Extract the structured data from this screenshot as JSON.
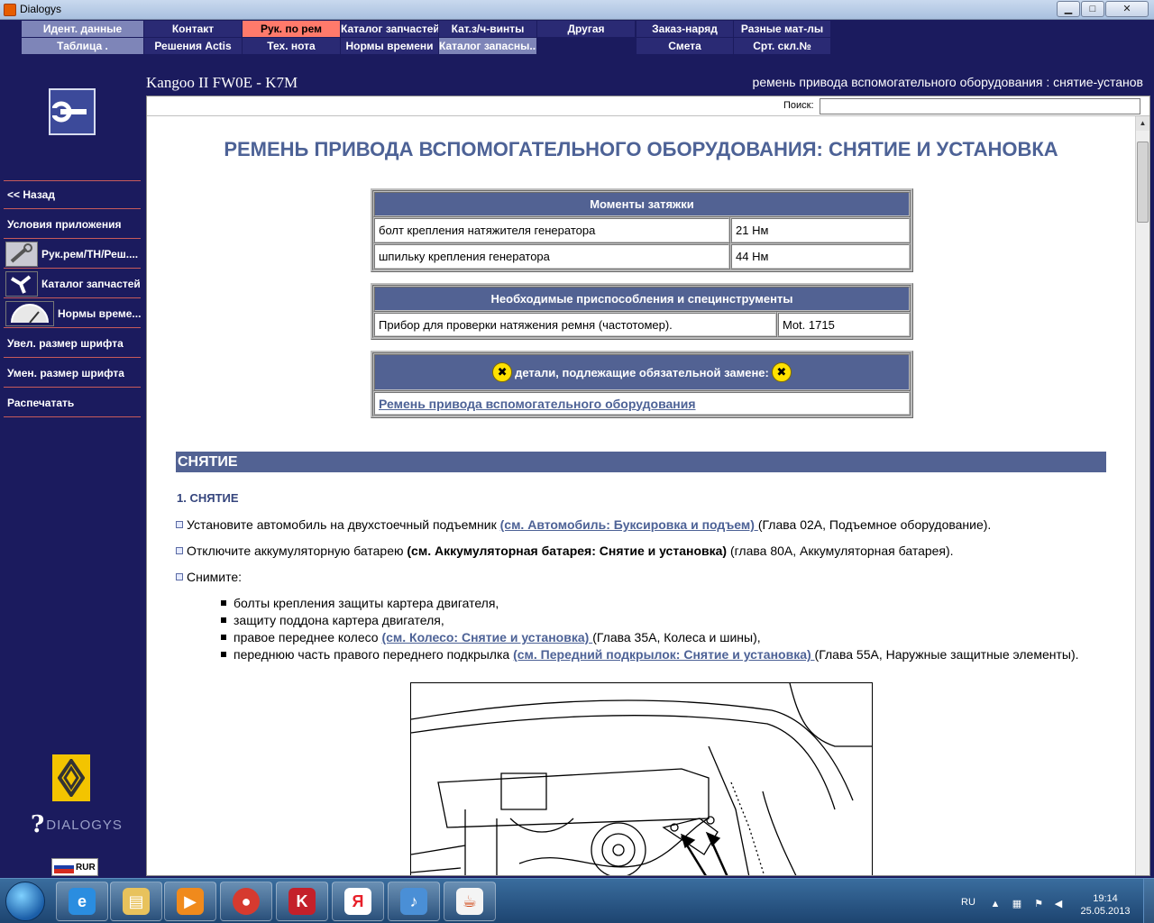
{
  "window": {
    "title": "Dialogys",
    "minimize": "▁",
    "maximize": "□",
    "close": "✕"
  },
  "menu": {
    "row1": [
      {
        "label": "Идент. данные",
        "style": "light",
        "w": 136
      },
      {
        "label": "Контакт",
        "style": "dark",
        "w": 109
      },
      {
        "label": "Рук. по рем",
        "style": "active",
        "w": 109
      },
      {
        "label": "Каталог запчастей",
        "style": "dark",
        "w": 109
      },
      {
        "label": "Кат.з/ч-винты",
        "style": "dark",
        "w": 109
      },
      {
        "label": "Другая",
        "style": "dark",
        "w": 109
      },
      {
        "label": "",
        "style": "blank",
        "w": 1
      },
      {
        "label": "Заказ-наряд",
        "style": "dark",
        "w": 108
      },
      {
        "label": "Разные мат-лы",
        "style": "dark",
        "w": 108
      }
    ],
    "row2": [
      {
        "label": "Таблица .",
        "style": "light",
        "w": 136
      },
      {
        "label": "Решения Actis",
        "style": "dark",
        "w": 109
      },
      {
        "label": "Тех. нота",
        "style": "dark",
        "w": 109
      },
      {
        "label": "Нормы времени",
        "style": "dark",
        "w": 109
      },
      {
        "label": "Каталог запасны...",
        "style": "light",
        "w": 109
      },
      {
        "label": "",
        "style": "blank",
        "w": 110
      },
      {
        "label": "Смета",
        "style": "dark",
        "w": 108
      },
      {
        "label": "Срт. скл.№",
        "style": "dark",
        "w": 108
      }
    ]
  },
  "header": {
    "vehicle": "Kangoo II FW0E - K7M",
    "procedure": "ремень привода вспомогательного оборудования : снятие-установ"
  },
  "sidebar": {
    "items": [
      {
        "label": "<< Назад",
        "thumb": ""
      },
      {
        "label": "Условия приложения",
        "thumb": ""
      },
      {
        "label": "Рук.рем/ТН/Реш....",
        "thumb": "wrench"
      },
      {
        "label": "Каталог запчастей",
        "thumb": "tool"
      },
      {
        "label": "Нормы време...",
        "thumb": "gauge"
      },
      {
        "label": "Увел. размер шрифта",
        "thumb": ""
      },
      {
        "label": "Умен. размер шрифта",
        "thumb": ""
      },
      {
        "label": "Распечатать",
        "thumb": ""
      }
    ],
    "brand": "DIALOGYS",
    "currency": "RUR"
  },
  "search": {
    "label": "Поиск:",
    "value": ""
  },
  "doc": {
    "title": "РЕМЕНЬ ПРИВОДА ВСПОМОГАТЕЛЬНОГО ОБОРУДОВАНИЯ: СНЯТИЕ И УСТАНОВКА",
    "torque": {
      "header": "Моменты затяжки",
      "rows": [
        {
          "item": "болт крепления натяжителя генератора",
          "value": "21 Нм"
        },
        {
          "item": "шпильку крепления генератора",
          "value": "44 Нм"
        }
      ]
    },
    "tools": {
      "header": "Необходимые приспособления и специнструменты",
      "rows": [
        {
          "item": "Прибор для проверки натяжения ремня (частотомер).",
          "value": "Mot. 1715"
        }
      ]
    },
    "parts": {
      "header": "детали, подлежащие обязательной замене:",
      "link": "Ремень привода вспомогательного оборудования"
    },
    "section": "СНЯТИЕ",
    "step": "1. СНЯТИЕ",
    "p1": {
      "text": "Установите автомобиль на двухстоечный подъемник ",
      "link": "(см. Автомобиль: Буксировка и подъем) ",
      "tail": "(Глава 02A, Подъемное оборудование)."
    },
    "p2": {
      "text": "Отключите аккумуляторную батарею ",
      "bold": "(см. Аккумуляторная батарея: Снятие и установка)",
      "tail": " (глава 80A, Аккумуляторная батарея)."
    },
    "p3": {
      "text": "Снимите:"
    },
    "sublist": [
      {
        "text": "болты крепления защиты картера двигателя,"
      },
      {
        "text": "защиту поддона картера двигателя,"
      },
      {
        "text": "правое переднее колесо ",
        "link": "(см. Колесо: Снятие и установка) ",
        "tail": "(Глава 35A, Колеса и шины),"
      },
      {
        "text": "переднюю часть правого переднего подкрылка ",
        "link": "(см. Передний подкрылок: Снятие и установка) ",
        "tail": "(Глава 55A, Наружные защитные элементы)."
      }
    ]
  },
  "taskbar": {
    "apps": [
      "ie-icon",
      "explorer-icon",
      "media-player-icon",
      "chrome-icon",
      "kaspersky-icon",
      "yandex-icon",
      "sound-icon",
      "java-icon"
    ],
    "lang": "RU",
    "time": "19:14",
    "date": "25.05.2013"
  },
  "colors": {
    "accent": "#526293",
    "menu_active": "#ff7a6b",
    "link": "#4d6296",
    "background": "#1b1b5e"
  }
}
